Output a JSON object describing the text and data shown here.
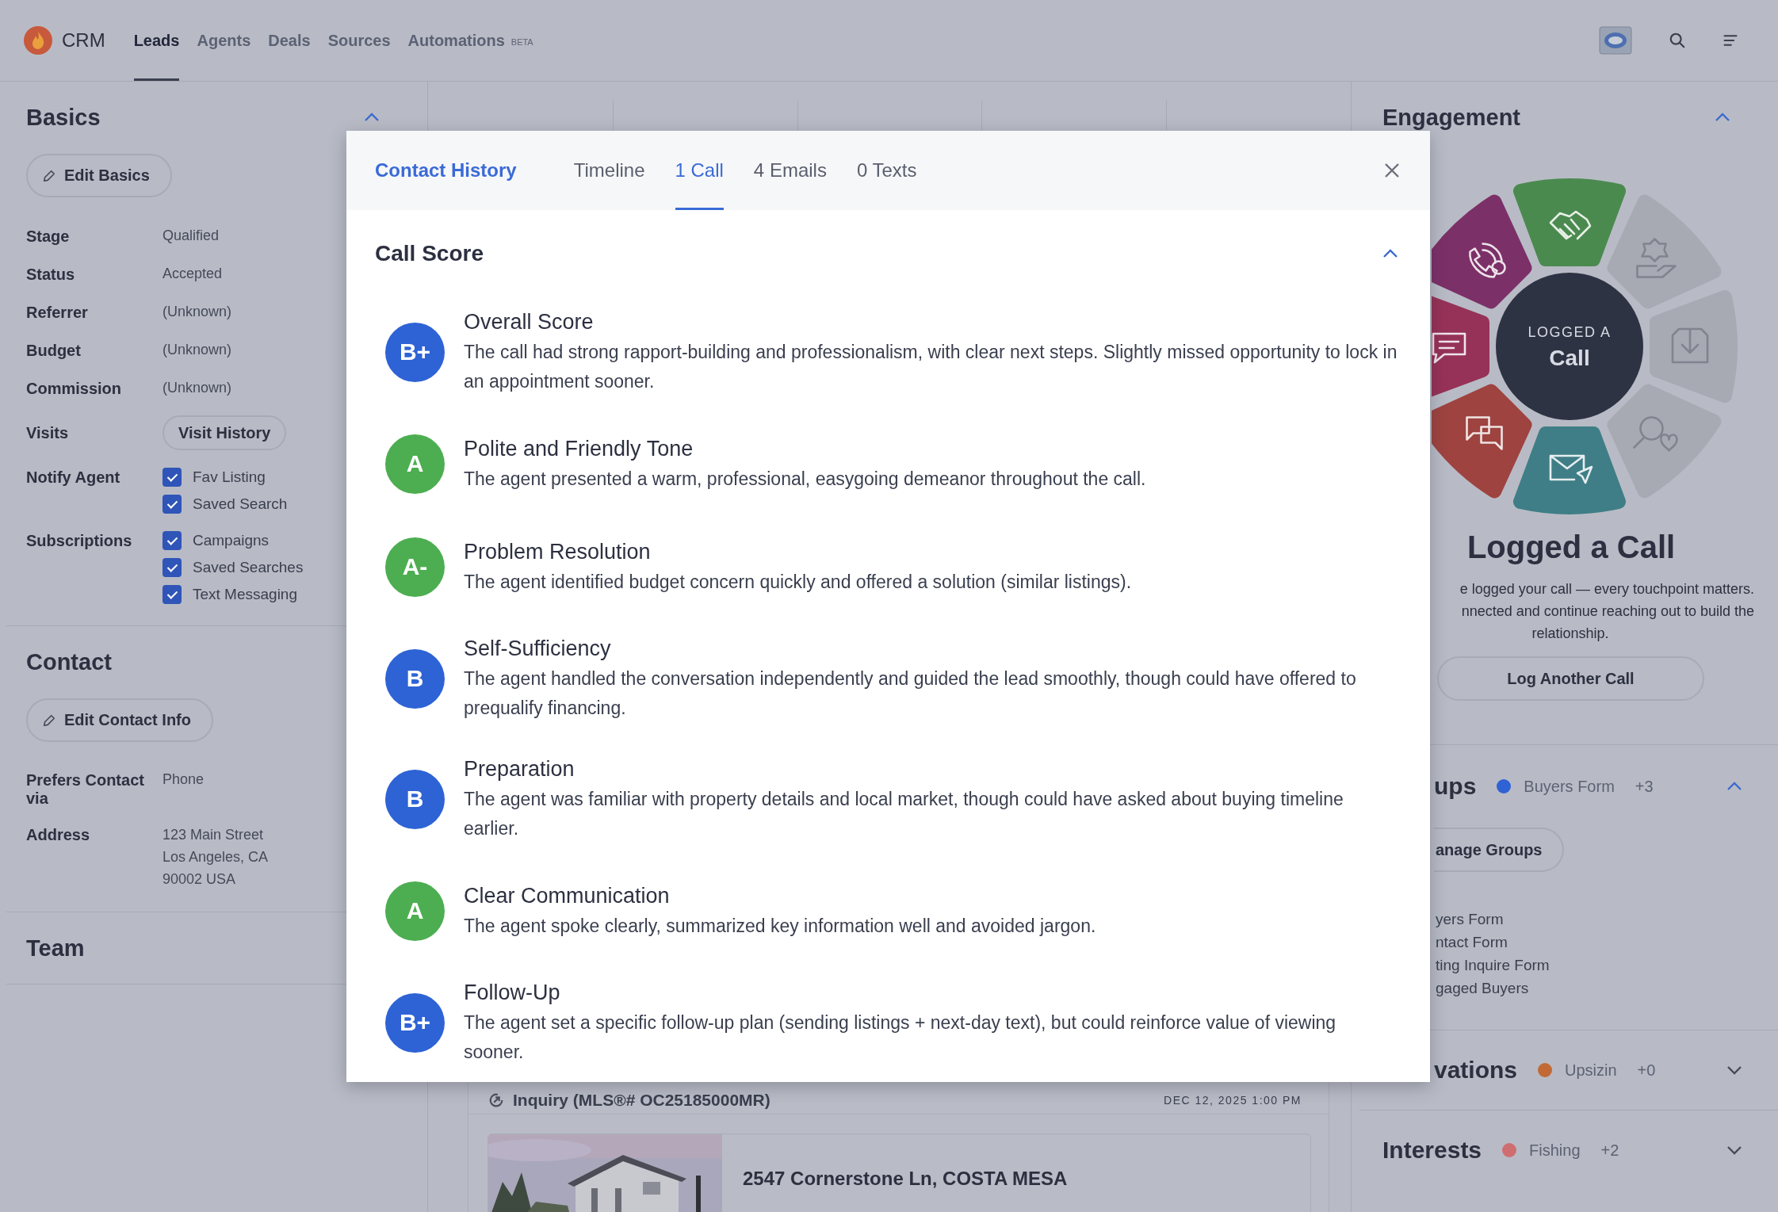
{
  "nav": {
    "brand": "CRM",
    "tabs": [
      {
        "label": "Leads",
        "selected": true
      },
      {
        "label": "Agents",
        "selected": false
      },
      {
        "label": "Deals",
        "selected": false
      },
      {
        "label": "Sources",
        "selected": false
      },
      {
        "label": "Automations",
        "badge": "BETA",
        "selected": false
      }
    ]
  },
  "basics": {
    "title": "Basics",
    "expanded": true,
    "edit_button": "Edit Basics",
    "fields": [
      {
        "label": "Stage",
        "kind": "text",
        "value": "Qualified"
      },
      {
        "label": "Status",
        "kind": "text",
        "value": "Accepted"
      },
      {
        "label": "Referrer",
        "kind": "text",
        "value": "(Unknown)"
      },
      {
        "label": "Budget",
        "kind": "text",
        "value": "(Unknown)"
      },
      {
        "label": "Commission",
        "kind": "text",
        "value": "(Unknown)"
      },
      {
        "label": "Visits",
        "kind": "button",
        "value": "Visit History"
      },
      {
        "label": "Notify Agent",
        "kind": "checkboxes",
        "options": [
          {
            "label": "Fav Listing",
            "checked": true
          },
          {
            "label": "Saved Search",
            "checked": true
          }
        ]
      },
      {
        "label": "Subscriptions",
        "kind": "checkboxes",
        "options": [
          {
            "label": "Campaigns",
            "checked": true
          },
          {
            "label": "Saved Searches",
            "checked": true
          },
          {
            "label": "Text Messaging",
            "checked": true
          }
        ]
      }
    ]
  },
  "contact": {
    "title": "Contact",
    "edit_button": "Edit Contact Info",
    "fields": [
      {
        "label": "Prefers Contact via",
        "kind": "text",
        "value": "Phone"
      },
      {
        "label": "Address",
        "kind": "lines",
        "lines": [
          "123 Main Street",
          "Los Angeles, CA",
          "90002 USA"
        ]
      }
    ]
  },
  "team": {
    "title": "Team"
  },
  "inquiry": {
    "title": "Inquiry (MLS®# OC25185000MR)",
    "date": "DEC 12, 2025 1:00 PM",
    "listing": {
      "address": "2547 Cornerstone Ln, COSTA MESA",
      "kind": "picture"
    }
  },
  "engagement": {
    "title": "Engagement",
    "expanded": true,
    "wheel": {
      "overline": "LOGGED A",
      "label": "Call"
    },
    "heading": "Logged a Call",
    "message_lines": [
      "e logged your call — every touchpoint matters.",
      "nnected and continue reaching out to build the",
      "relationship."
    ],
    "button": "Log Another Call"
  },
  "sections": [
    {
      "title": "ups",
      "expanded": true,
      "summary": {
        "label": "Buyers Form",
        "color": "#2f62d4",
        "more": "+3"
      },
      "button": "anage Groups",
      "items": [
        "yers Form",
        "ntact Form",
        "ting Inquire Form",
        "gaged Buyers"
      ]
    },
    {
      "title": "vations",
      "expanded": false,
      "summary": {
        "label": "Upsizin",
        "color": "#c26a36",
        "more": "+0"
      }
    },
    {
      "title": "Interests",
      "expanded": false,
      "summary": {
        "label": "Fishing",
        "color": "#cf6e71",
        "more": "+2"
      }
    }
  ],
  "modal": {
    "title": "Contact History",
    "tabs": [
      {
        "label": "Timeline",
        "selected": false
      },
      {
        "label": "1 Call",
        "selected": true
      },
      {
        "label": "4 Emails",
        "selected": false
      },
      {
        "label": "0 Texts",
        "selected": false
      }
    ],
    "call_score": {
      "title": "Call Score",
      "expanded": true,
      "items": [
        {
          "grade": "B+",
          "color": "#2e63d6",
          "title": "Overall Score",
          "text": "The call had strong rapport-building and professionalism, with clear next steps. Slightly missed opportunity to lock in an appointment sooner."
        },
        {
          "grade": "A",
          "color": "#4cae50",
          "title": "Polite and Friendly Tone",
          "text": "The agent presented a warm, professional, easygoing demeanor throughout the call."
        },
        {
          "grade": "A-",
          "color": "#4cae50",
          "title": "Problem Resolution",
          "text": "The agent identified budget concern quickly and offered a solution (similar listings)."
        },
        {
          "grade": "B",
          "color": "#2e63d6",
          "title": "Self-Sufficiency",
          "text": "The agent handled the conversation independently and guided the lead smoothly, though could have offered to prequalify financing."
        },
        {
          "grade": "B",
          "color": "#2e63d6",
          "title": "Preparation",
          "text": "The agent was familiar with property details and local market, though could have asked about buying timeline earlier."
        },
        {
          "grade": "A",
          "color": "#4cae50",
          "title": "Clear Communication",
          "text": "The agent spoke clearly, summarized key information well and avoided jargon."
        },
        {
          "grade": "B+",
          "color": "#2e63d6",
          "title": "Follow-Up",
          "text": "The agent set a specific follow-up plan (sending listings + next-day text), but could reinforce value of viewing sooner."
        }
      ]
    }
  }
}
